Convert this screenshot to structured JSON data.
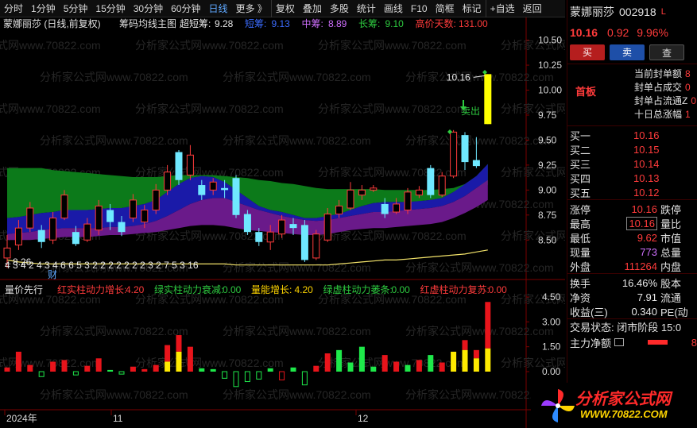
{
  "toolbar": {
    "items": [
      "分时",
      "1分钟",
      "5分钟",
      "15分钟",
      "30分钟",
      "60分钟",
      "日线",
      "更多 》",
      "复权",
      "叠加",
      "多股",
      "统计",
      "画线",
      "F10",
      "简框",
      "标记",
      "+自选",
      "返回"
    ],
    "active": "日线"
  },
  "main_header": {
    "stock_label": "蒙娜丽莎 (日线,前复权)",
    "indicator_name": "筹码均线主图",
    "items": [
      {
        "label": "超短筹:",
        "value": "9.28",
        "color": "#e8e8e8"
      },
      {
        "label": "短筹:",
        "value": "9.13",
        "color": "#3b6cff"
      },
      {
        "label": "中筹:",
        "value": "8.89",
        "color": "#d070ff"
      },
      {
        "label": "长筹:",
        "value": "9.10",
        "color": "#2ecc40"
      },
      {
        "label": "高价天数:",
        "value": "131.00",
        "color": "#ff3b3b"
      }
    ]
  },
  "price_axis": {
    "ticks": [
      "10.50",
      "10.25",
      "10.00",
      "9.75",
      "9.50",
      "9.25",
      "9.00",
      "8.75",
      "8.50"
    ]
  },
  "volume_axis": {
    "ticks": [
      "4.50",
      "3.00",
      "1.50",
      "0.00"
    ]
  },
  "annotations": {
    "high_price": "10.16",
    "low_price": "8.26",
    "sell_label": "卖出",
    "fin_label": "财",
    "count_row": "4 3  4 2   4   3 4 6 6 5 3         2          2   2 2 2   2 2 3 2 7 5 3 16"
  },
  "volume_header": {
    "name": "量价先行",
    "items": [
      {
        "label": "红实柱动力增长:",
        "value": "4.20",
        "color": "#ff3b3b"
      },
      {
        "label": "绿实柱动力衰减:",
        "value": "0.00",
        "color": "#2ecc40"
      },
      {
        "label": "量能增长:",
        "value": "4.20",
        "color": "#ffd500"
      },
      {
        "label": "绿虚柱动力萎条:",
        "value": "0.00",
        "color": "#2ecc40"
      },
      {
        "label": "红虚柱动力复苏:",
        "value": "0.00",
        "color": "#ff3b3b"
      }
    ]
  },
  "time_axis": {
    "labels": [
      "2024年",
      "11",
      "12"
    ]
  },
  "watermark": "分析家公式网www.70822.com",
  "chart_data": {
    "type": "candlestick",
    "ylim": [
      8.2,
      10.6
    ],
    "candles": [
      {
        "o": 8.32,
        "c": 8.42,
        "h": 8.55,
        "l": 8.22
      },
      {
        "o": 8.45,
        "c": 8.62,
        "h": 8.7,
        "l": 8.4
      },
      {
        "o": 8.62,
        "c": 8.82,
        "h": 8.88,
        "l": 8.58
      },
      {
        "o": 8.6,
        "c": 8.48,
        "h": 8.65,
        "l": 8.42
      },
      {
        "o": 8.5,
        "c": 8.72,
        "h": 8.78,
        "l": 8.46
      },
      {
        "o": 8.72,
        "c": 8.95,
        "h": 9.0,
        "l": 8.7
      },
      {
        "o": 8.58,
        "c": 8.46,
        "h": 8.64,
        "l": 8.44
      },
      {
        "o": 8.5,
        "c": 8.66,
        "h": 8.72,
        "l": 8.48
      },
      {
        "o": 8.6,
        "c": 8.84,
        "h": 8.9,
        "l": 8.55
      },
      {
        "o": 8.8,
        "c": 8.68,
        "h": 8.86,
        "l": 8.6
      },
      {
        "o": 8.68,
        "c": 8.58,
        "h": 8.74,
        "l": 8.54
      },
      {
        "o": 8.72,
        "c": 8.9,
        "h": 8.96,
        "l": 8.68
      },
      {
        "o": 8.68,
        "c": 8.8,
        "h": 8.85,
        "l": 8.62
      },
      {
        "o": 8.8,
        "c": 9.0,
        "h": 9.06,
        "l": 8.76
      },
      {
        "o": 9.0,
        "c": 9.18,
        "h": 9.25,
        "l": 8.95
      },
      {
        "o": 9.38,
        "c": 9.1,
        "h": 9.4,
        "l": 9.05
      },
      {
        "o": 9.15,
        "c": 9.35,
        "h": 9.45,
        "l": 9.1
      },
      {
        "o": 9.05,
        "c": 8.95,
        "h": 9.1,
        "l": 8.9
      },
      {
        "o": 9.0,
        "c": 9.08,
        "h": 9.12,
        "l": 8.95
      },
      {
        "o": 9.02,
        "c": 9.0,
        "h": 9.1,
        "l": 8.92
      },
      {
        "o": 9.12,
        "c": 8.75,
        "h": 9.15,
        "l": 8.72
      },
      {
        "o": 8.76,
        "c": 8.58,
        "h": 8.8,
        "l": 8.55
      },
      {
        "o": 8.58,
        "c": 8.48,
        "h": 8.62,
        "l": 8.44
      },
      {
        "o": 8.48,
        "c": 8.58,
        "h": 8.65,
        "l": 8.4
      },
      {
        "o": 8.56,
        "c": 8.7,
        "h": 8.75,
        "l": 8.52
      },
      {
        "o": 8.66,
        "c": 8.62,
        "h": 8.72,
        "l": 8.55
      },
      {
        "o": 8.65,
        "c": 8.3,
        "h": 8.7,
        "l": 8.28
      },
      {
        "o": 8.32,
        "c": 8.56,
        "h": 8.6,
        "l": 8.3
      },
      {
        "o": 8.5,
        "c": 8.76,
        "h": 8.82,
        "l": 8.48
      },
      {
        "o": 8.76,
        "c": 8.84,
        "h": 8.9,
        "l": 8.72
      },
      {
        "o": 8.82,
        "c": 9.0,
        "h": 9.08,
        "l": 8.8
      },
      {
        "o": 8.95,
        "c": 9.0,
        "h": 9.05,
        "l": 8.9
      },
      {
        "o": 9.0,
        "c": 9.02,
        "h": 9.05,
        "l": 8.98
      },
      {
        "o": 8.86,
        "c": 8.76,
        "h": 8.92,
        "l": 8.72
      },
      {
        "o": 8.78,
        "c": 8.86,
        "h": 8.92,
        "l": 8.76
      },
      {
        "o": 8.8,
        "c": 8.98,
        "h": 9.02,
        "l": 8.76
      },
      {
        "o": 8.95,
        "c": 9.0,
        "h": 9.04,
        "l": 8.92
      },
      {
        "o": 9.22,
        "c": 8.95,
        "h": 9.25,
        "l": 8.92
      },
      {
        "o": 8.95,
        "c": 9.14,
        "h": 9.18,
        "l": 8.93
      },
      {
        "o": 9.14,
        "c": 9.58,
        "h": 9.6,
        "l": 9.12
      },
      {
        "o": 9.55,
        "c": 9.28,
        "h": 9.58,
        "l": 9.2
      },
      {
        "o": 9.3,
        "c": 9.24,
        "h": 9.53,
        "l": 9.22
      },
      {
        "o": 9.66,
        "c": 10.16,
        "h": 10.16,
        "l": 9.66
      }
    ],
    "ribbons": {
      "long_green": [
        9.22,
        9.22,
        9.22,
        9.22,
        9.2,
        9.19,
        9.18,
        9.17,
        9.16,
        9.15,
        9.14,
        9.13,
        9.13,
        9.13,
        9.14,
        9.15,
        9.15,
        9.15,
        9.15,
        9.14,
        9.13,
        9.12,
        9.1,
        9.09,
        9.07,
        9.06,
        9.04,
        9.02,
        9.01,
        9.01,
        9.01,
        9.01,
        9.01,
        9.0,
        9.0,
        9.0,
        9.0,
        9.0,
        9.01,
        9.02,
        9.03,
        9.04,
        9.05
      ],
      "short_blue": [
        8.72,
        8.73,
        8.75,
        8.77,
        8.78,
        8.8,
        8.8,
        8.8,
        8.81,
        8.82,
        8.82,
        8.84,
        8.86,
        8.9,
        8.98,
        9.06,
        9.12,
        9.14,
        9.13,
        9.08,
        9.0,
        8.92,
        8.84,
        8.8,
        8.78,
        8.75,
        8.72,
        8.72,
        8.74,
        8.76,
        8.8,
        8.84,
        8.87,
        8.88,
        8.88,
        8.88,
        8.89,
        8.9,
        8.92,
        8.98,
        9.06,
        9.14,
        9.26
      ],
      "mid_purple": [
        8.56,
        8.57,
        8.58,
        8.6,
        8.61,
        8.62,
        8.62,
        8.62,
        8.62,
        8.63,
        8.63,
        8.64,
        8.66,
        8.69,
        8.74,
        8.8,
        8.86,
        8.9,
        8.92,
        8.92,
        8.88,
        8.84,
        8.8,
        8.77,
        8.74,
        8.72,
        8.7,
        8.69,
        8.7,
        8.72,
        8.74,
        8.76,
        8.78,
        8.78,
        8.79,
        8.8,
        8.81,
        8.82,
        8.84,
        8.88,
        8.94,
        9.02,
        9.1
      ],
      "bottom": [
        8.5,
        8.5,
        8.5,
        8.51,
        8.52,
        8.53,
        8.53,
        8.53,
        8.54,
        8.55,
        8.55,
        8.56,
        8.57,
        8.58,
        8.6,
        8.62,
        8.64,
        8.65,
        8.65,
        8.64,
        8.62,
        8.6,
        8.59,
        8.58,
        8.57,
        8.56,
        8.55,
        8.55,
        8.56,
        8.58,
        8.6,
        8.61,
        8.62,
        8.62,
        8.63,
        8.64,
        8.65,
        8.66,
        8.68,
        8.72,
        8.77,
        8.83,
        8.9
      ]
    },
    "support_line": [
      8.3,
      8.28,
      8.27,
      8.26,
      8.26,
      8.26,
      8.26,
      8.26,
      8.26,
      8.26,
      8.26,
      8.26,
      8.26,
      8.26,
      8.26,
      8.26,
      8.26,
      8.26,
      8.26,
      8.26,
      8.25,
      8.25,
      8.25,
      8.25,
      8.25,
      8.25,
      8.25,
      8.25,
      8.25,
      8.26,
      8.27,
      8.28,
      8.29,
      8.3,
      8.3,
      8.31,
      8.32,
      8.33,
      8.34,
      8.35,
      8.36,
      8.38,
      8.4
    ],
    "volume": [
      {
        "v": 0.25,
        "y": 0,
        "t": "red"
      },
      {
        "v": 1.2,
        "y": 0,
        "t": "red"
      },
      {
        "v": 0.4,
        "y": 0,
        "t": "red"
      },
      {
        "v": -0.3,
        "y": 0,
        "t": "green_hollow"
      },
      {
        "v": 0.6,
        "y": 0,
        "t": "red"
      },
      {
        "v": 0.7,
        "y": 0,
        "t": "red"
      },
      {
        "v": -0.2,
        "y": 0,
        "t": "green_hollow"
      },
      {
        "v": 0.35,
        "y": 0,
        "t": "red"
      },
      {
        "v": 0.8,
        "y": 0,
        "t": "red"
      },
      {
        "v": 0.1,
        "y": 0,
        "t": "green"
      },
      {
        "v": -0.15,
        "y": 0,
        "t": "green_hollow"
      },
      {
        "v": 0.3,
        "y": 0,
        "t": "red"
      },
      {
        "v": 0.15,
        "y": 0,
        "t": "red"
      },
      {
        "v": 0.4,
        "y": 0,
        "t": "red"
      },
      {
        "v": 1.6,
        "y": 0.6,
        "t": "red_yellow"
      },
      {
        "v": 2.2,
        "y": 1.2,
        "t": "red_yellow"
      },
      {
        "v": 1.5,
        "y": 0,
        "t": "red"
      },
      {
        "v": 0.2,
        "y": 0,
        "t": "green"
      },
      {
        "v": 0.15,
        "y": 0,
        "t": "green"
      },
      {
        "v": -0.4,
        "y": 0,
        "t": "green_hollow"
      },
      {
        "v": -0.9,
        "y": 0,
        "t": "green_hollow"
      },
      {
        "v": -0.6,
        "y": 0,
        "t": "green_hollow"
      },
      {
        "v": -0.45,
        "y": 0,
        "t": "green_hollow"
      },
      {
        "v": 0.2,
        "y": 0,
        "t": "green"
      },
      {
        "v": -0.5,
        "y": 0,
        "t": "red_hollow"
      },
      {
        "v": 0.25,
        "y": 0,
        "t": "green"
      },
      {
        "v": -0.8,
        "y": 0,
        "t": "green_hollow"
      },
      {
        "v": 0.35,
        "y": 0,
        "t": "red"
      },
      {
        "v": 1.1,
        "y": 0,
        "t": "red"
      },
      {
        "v": 1.3,
        "y": 0,
        "t": "green"
      },
      {
        "v": 0.55,
        "y": 0,
        "t": "green"
      },
      {
        "v": 1.5,
        "y": 0,
        "t": "green"
      },
      {
        "v": 0.3,
        "y": 0,
        "t": "green"
      },
      {
        "v": 1.0,
        "y": 0,
        "t": "red"
      },
      {
        "v": 0.6,
        "y": 0,
        "t": "red"
      },
      {
        "v": 0.4,
        "y": 0,
        "t": "green"
      },
      {
        "v": 0.7,
        "y": 0,
        "t": "red"
      },
      {
        "v": 1.0,
        "y": 0,
        "t": "green"
      },
      {
        "v": 0.55,
        "y": 0,
        "t": "red"
      },
      {
        "v": 1.2,
        "y": 0,
        "t": "red_yellow_half"
      },
      {
        "v": 1.9,
        "y": 1.3,
        "t": "red_yellow"
      },
      {
        "v": 1.3,
        "y": 0.8,
        "t": "red_yellow"
      },
      {
        "v": 4.2,
        "y": 1.4,
        "t": "red_yellow"
      }
    ]
  },
  "right_panel": {
    "stock_name": "蒙娜丽莎",
    "stock_code": "002918",
    "price": "10.16",
    "change": "0.92",
    "change_pct": "9.96%",
    "buttons": [
      "买",
      "卖",
      "查"
    ],
    "seal_tag": "首板",
    "seal_rows": [
      {
        "label": "当前封单额",
        "value": "8"
      },
      {
        "label": "封单占成交",
        "value": "0"
      },
      {
        "label": "封单占流通Z",
        "value": "0"
      },
      {
        "label": "十日总涨幅",
        "value": "1"
      }
    ],
    "book": [
      {
        "label": "买一",
        "value": "10.16"
      },
      {
        "label": "买二",
        "value": "10.15"
      },
      {
        "label": "买三",
        "value": "10.14"
      },
      {
        "label": "买四",
        "value": "10.13"
      },
      {
        "label": "买五",
        "value": "10.12"
      }
    ],
    "stats": [
      {
        "l1": "涨停",
        "v1": "10.16",
        "c1": "red",
        "l2": "跌停",
        "boxed": false
      },
      {
        "l1": "最高",
        "v1": "10.16",
        "c1": "red",
        "l2": "量比",
        "boxed": true
      },
      {
        "l1": "最低",
        "v1": "9.62",
        "c1": "red",
        "l2": "市值",
        "boxed": false
      },
      {
        "l1": "现量",
        "v1": "773",
        "c1": "purple",
        "l2": "总量",
        "boxed": false
      },
      {
        "l1": "外盘",
        "v1": "111264",
        "c1": "red",
        "l2": "内盘",
        "boxed": false
      }
    ],
    "stats2": [
      {
        "l1": "换手",
        "v1": "16.46%",
        "l2": "股本"
      },
      {
        "l1": "净资",
        "v1": "7.91",
        "l2": "流通"
      },
      {
        "l1": "收益(三)",
        "v1": "0.340",
        "l2": "PE(动"
      }
    ],
    "trade_state": "交易状态: 闭市阶段 15:0",
    "main_flow_label": "主力净额",
    "main_flow_value": "8",
    "logo_main": "分析家公式网",
    "logo_sub": "WWW.70822.COM"
  }
}
